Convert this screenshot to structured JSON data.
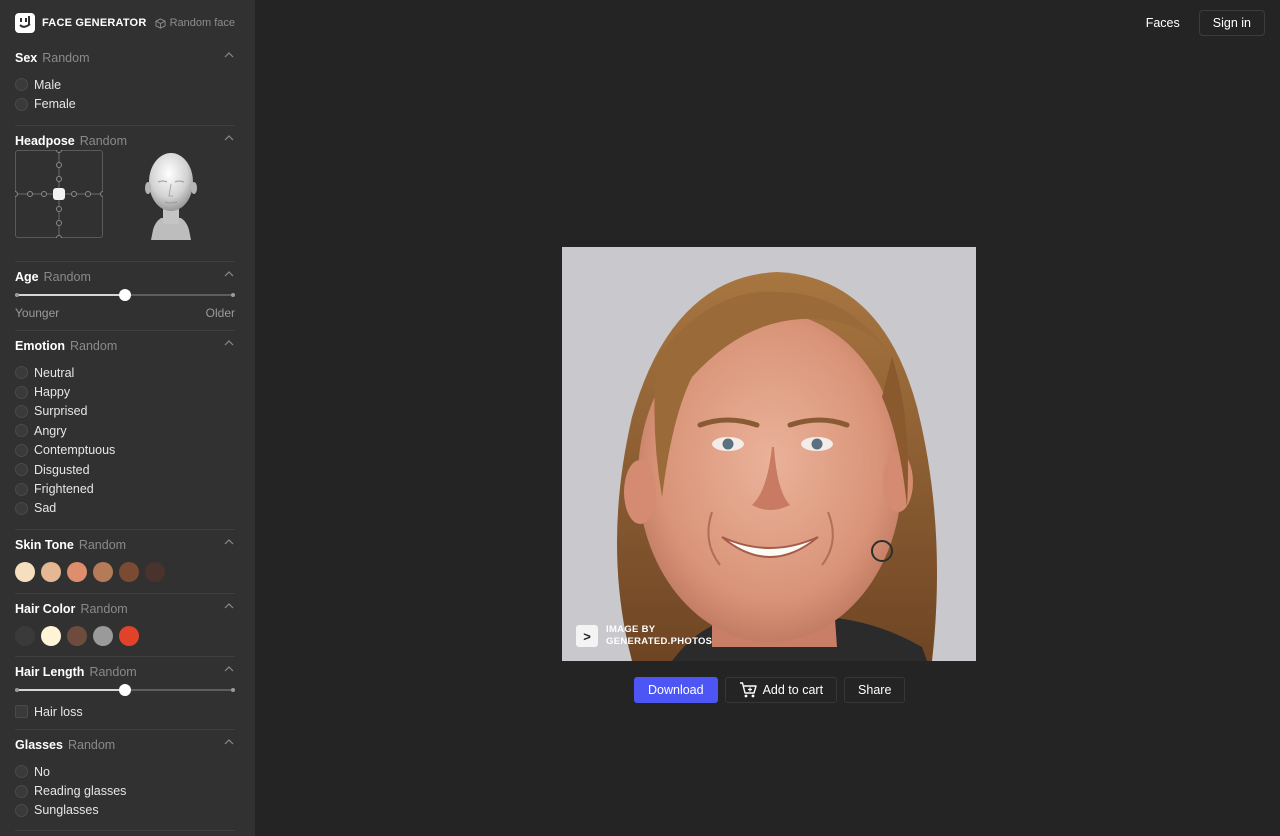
{
  "brand": {
    "title": "FACE GENERATOR",
    "random_face": "Random face"
  },
  "nav": {
    "faces": "Faces",
    "sign_in": "Sign in"
  },
  "sections": {
    "sex": {
      "title": "Sex",
      "sub": "Random",
      "options": [
        "Male",
        "Female"
      ]
    },
    "headpose": {
      "title": "Headpose",
      "sub": "Random"
    },
    "age": {
      "title": "Age",
      "sub": "Random",
      "min_label": "Younger",
      "max_label": "Older",
      "value": 0.5
    },
    "emotion": {
      "title": "Emotion",
      "sub": "Random",
      "options": [
        "Neutral",
        "Happy",
        "Surprised",
        "Angry",
        "Contemptuous",
        "Disgusted",
        "Frightened",
        "Sad"
      ]
    },
    "skin_tone": {
      "title": "Skin Tone",
      "sub": "Random",
      "colors": [
        "#f5dfbf",
        "#e5b893",
        "#de8e6c",
        "#b57b58",
        "#7b4a33",
        "#4a332c"
      ]
    },
    "hair_color": {
      "title": "Hair Color",
      "sub": "Random",
      "colors": [
        "#3a3a3a",
        "#fff4d6",
        "#6e4c3d",
        "#9a9a9a",
        "#e0432a"
      ]
    },
    "hair_length": {
      "title": "Hair Length",
      "sub": "Random",
      "value": 0.5,
      "hair_loss": "Hair loss"
    },
    "glasses": {
      "title": "Glasses",
      "sub": "Random",
      "options": [
        "No",
        "Reading glasses",
        "Sunglasses"
      ]
    }
  },
  "photo": {
    "watermark_line1": "IMAGE BY",
    "watermark_line2": "GENERATED.PHOTOS"
  },
  "actions": {
    "download": "Download",
    "add_to_cart": "Add to cart",
    "share": "Share"
  },
  "colors": {
    "accent": "#4d56f5",
    "sidebar_bg": "#313131",
    "page_bg": "#242424"
  }
}
